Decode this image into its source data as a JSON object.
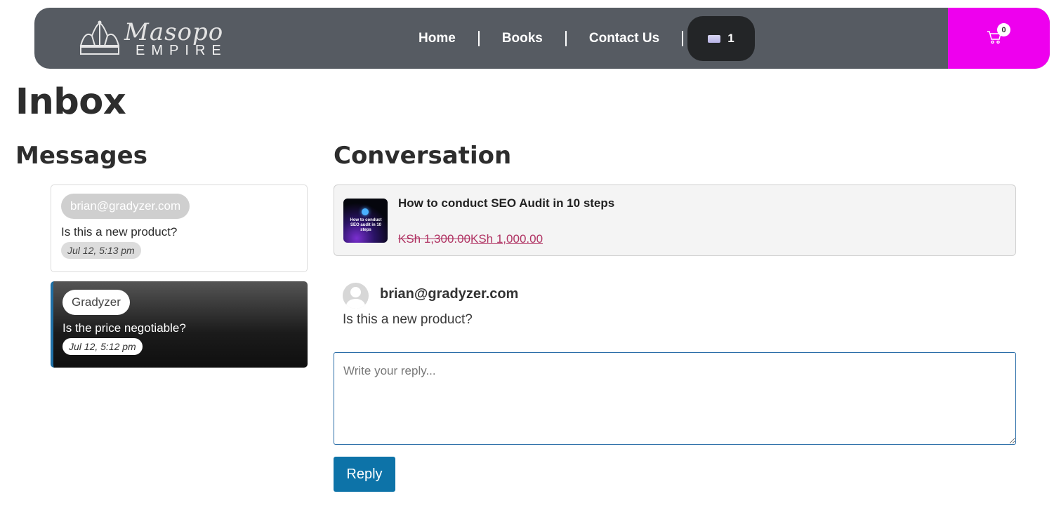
{
  "header": {
    "logo": {
      "script": "Masopo",
      "sub": "EMPIRE"
    },
    "nav": [
      "Home",
      "Books",
      "Contact Us"
    ],
    "language": {
      "count": "1"
    },
    "cart": {
      "count": "0",
      "background": "#ee00ee"
    }
  },
  "page": {
    "title": "Inbox"
  },
  "messages": {
    "title": "Messages",
    "items": [
      {
        "sender": "brian@gradyzer.com",
        "text": "Is this a new product?",
        "time": "Jul 12, 5:13 pm"
      },
      {
        "sender": "Gradyzer",
        "text": "Is the price negotiable?",
        "time": "Jul 12, 5:12 pm"
      }
    ]
  },
  "conversation": {
    "title": "Conversation",
    "product": {
      "title": "How to conduct SEO Audit in 10 steps",
      "thumb_text": "How to conduct SEO audit in 10 steps",
      "old_price": "KSh 1,300.00",
      "new_price": "KSh 1,000.00"
    },
    "message": {
      "sender": "brian@gradyzer.com",
      "text": "Is this a new product?"
    },
    "reply": {
      "placeholder": "Write your reply...",
      "button": "Reply"
    }
  },
  "colors": {
    "header_bg": "#565b62",
    "accent": "#0d73a8",
    "price": "#b03363"
  }
}
